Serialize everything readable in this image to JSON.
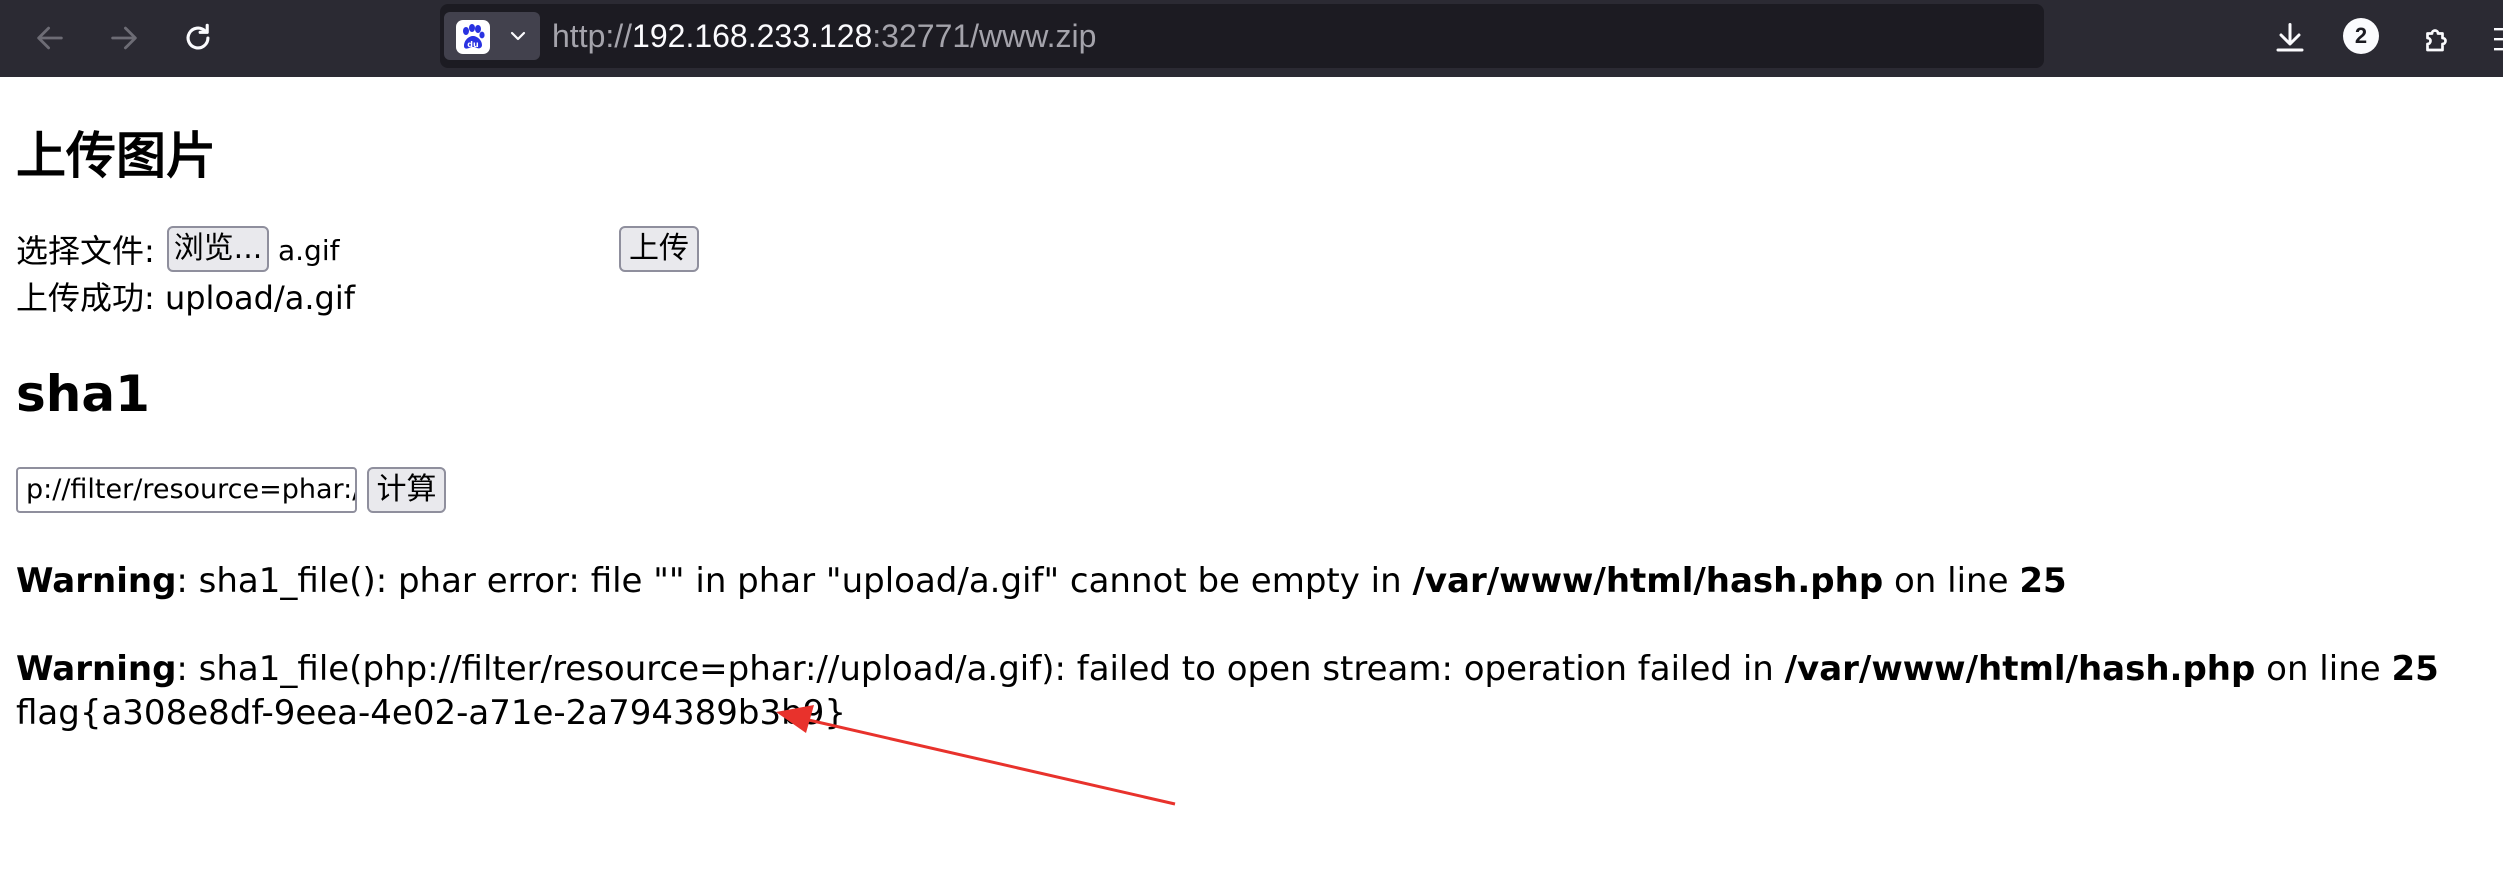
{
  "browser": {
    "url_scheme": "http://",
    "url_host": "192.168.233.128",
    "url_rest": ":32771/www.zip",
    "download_count": "2",
    "icons": {
      "back": "arrow-left-icon",
      "forward": "arrow-right-icon",
      "reload": "reload-icon",
      "site": "baidu-paw-icon",
      "site_menu": "chevron-down-icon",
      "downloads": "download-icon",
      "extensions": "puzzle-icon",
      "menu": "hamburger-menu-icon"
    }
  },
  "upload": {
    "heading": "上传图片",
    "choose_label": "选择文件:",
    "browse_button": "浏览...",
    "selected_file": "a.gif",
    "upload_button": "上传",
    "success_text": "上传成功: upload/a.gif"
  },
  "sha1": {
    "heading": "sha1",
    "input_value": "p://filter/resource=phar://",
    "calc_button": "计算"
  },
  "warnings": [
    {
      "label": "Warning",
      "message": ": sha1_file(): phar error: file \"\" in phar \"upload/a.gif\" cannot be empty in ",
      "path": "/var/www/html/hash.php",
      "line_text": " on line ",
      "line_number": "25"
    },
    {
      "label": "Warning",
      "message": ": sha1_file(php://filter/resource=phar://upload/a.gif): failed to open stream: operation failed in ",
      "path": "/var/www/html/hash.php",
      "line_text": " on line ",
      "line_number": "25"
    }
  ],
  "flag": "flag{a308e8df-9eea-4e02-a71e-2a794389b3b9}",
  "colors": {
    "toolbar_bg": "#2b2a33",
    "urlbar_bg": "#1c1b22",
    "annotation_arrow": "#e8322c",
    "baidu_blue": "#2932e1"
  }
}
